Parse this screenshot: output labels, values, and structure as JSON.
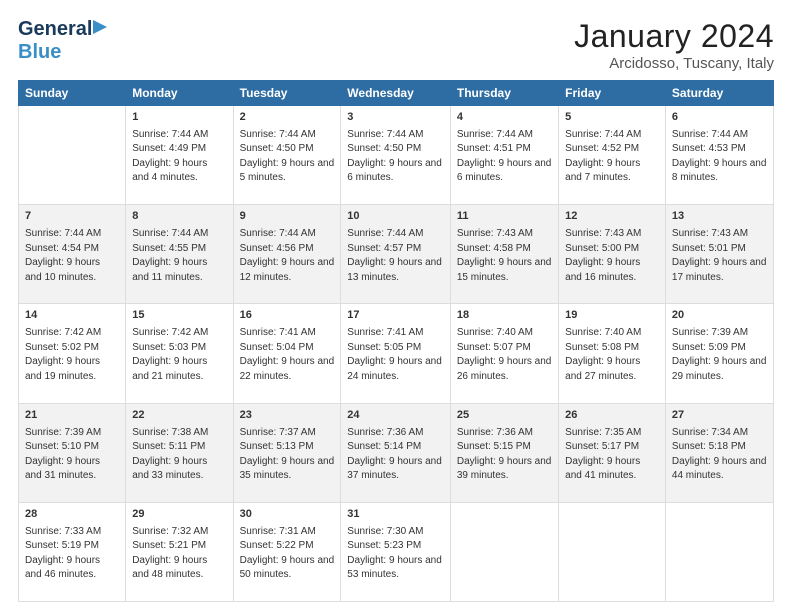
{
  "header": {
    "logo_line1": "General",
    "logo_line2": "Blue",
    "title": "January 2024",
    "subtitle": "Arcidosso, Tuscany, Italy"
  },
  "columns": [
    "Sunday",
    "Monday",
    "Tuesday",
    "Wednesday",
    "Thursday",
    "Friday",
    "Saturday"
  ],
  "rows": [
    [
      {
        "day": "",
        "sunrise": "",
        "sunset": "",
        "daylight": ""
      },
      {
        "day": "1",
        "sunrise": "Sunrise: 7:44 AM",
        "sunset": "Sunset: 4:49 PM",
        "daylight": "Daylight: 9 hours and 4 minutes."
      },
      {
        "day": "2",
        "sunrise": "Sunrise: 7:44 AM",
        "sunset": "Sunset: 4:50 PM",
        "daylight": "Daylight: 9 hours and 5 minutes."
      },
      {
        "day": "3",
        "sunrise": "Sunrise: 7:44 AM",
        "sunset": "Sunset: 4:50 PM",
        "daylight": "Daylight: 9 hours and 6 minutes."
      },
      {
        "day": "4",
        "sunrise": "Sunrise: 7:44 AM",
        "sunset": "Sunset: 4:51 PM",
        "daylight": "Daylight: 9 hours and 6 minutes."
      },
      {
        "day": "5",
        "sunrise": "Sunrise: 7:44 AM",
        "sunset": "Sunset: 4:52 PM",
        "daylight": "Daylight: 9 hours and 7 minutes."
      },
      {
        "day": "6",
        "sunrise": "Sunrise: 7:44 AM",
        "sunset": "Sunset: 4:53 PM",
        "daylight": "Daylight: 9 hours and 8 minutes."
      }
    ],
    [
      {
        "day": "7",
        "sunrise": "Sunrise: 7:44 AM",
        "sunset": "Sunset: 4:54 PM",
        "daylight": "Daylight: 9 hours and 10 minutes."
      },
      {
        "day": "8",
        "sunrise": "Sunrise: 7:44 AM",
        "sunset": "Sunset: 4:55 PM",
        "daylight": "Daylight: 9 hours and 11 minutes."
      },
      {
        "day": "9",
        "sunrise": "Sunrise: 7:44 AM",
        "sunset": "Sunset: 4:56 PM",
        "daylight": "Daylight: 9 hours and 12 minutes."
      },
      {
        "day": "10",
        "sunrise": "Sunrise: 7:44 AM",
        "sunset": "Sunset: 4:57 PM",
        "daylight": "Daylight: 9 hours and 13 minutes."
      },
      {
        "day": "11",
        "sunrise": "Sunrise: 7:43 AM",
        "sunset": "Sunset: 4:58 PM",
        "daylight": "Daylight: 9 hours and 15 minutes."
      },
      {
        "day": "12",
        "sunrise": "Sunrise: 7:43 AM",
        "sunset": "Sunset: 5:00 PM",
        "daylight": "Daylight: 9 hours and 16 minutes."
      },
      {
        "day": "13",
        "sunrise": "Sunrise: 7:43 AM",
        "sunset": "Sunset: 5:01 PM",
        "daylight": "Daylight: 9 hours and 17 minutes."
      }
    ],
    [
      {
        "day": "14",
        "sunrise": "Sunrise: 7:42 AM",
        "sunset": "Sunset: 5:02 PM",
        "daylight": "Daylight: 9 hours and 19 minutes."
      },
      {
        "day": "15",
        "sunrise": "Sunrise: 7:42 AM",
        "sunset": "Sunset: 5:03 PM",
        "daylight": "Daylight: 9 hours and 21 minutes."
      },
      {
        "day": "16",
        "sunrise": "Sunrise: 7:41 AM",
        "sunset": "Sunset: 5:04 PM",
        "daylight": "Daylight: 9 hours and 22 minutes."
      },
      {
        "day": "17",
        "sunrise": "Sunrise: 7:41 AM",
        "sunset": "Sunset: 5:05 PM",
        "daylight": "Daylight: 9 hours and 24 minutes."
      },
      {
        "day": "18",
        "sunrise": "Sunrise: 7:40 AM",
        "sunset": "Sunset: 5:07 PM",
        "daylight": "Daylight: 9 hours and 26 minutes."
      },
      {
        "day": "19",
        "sunrise": "Sunrise: 7:40 AM",
        "sunset": "Sunset: 5:08 PM",
        "daylight": "Daylight: 9 hours and 27 minutes."
      },
      {
        "day": "20",
        "sunrise": "Sunrise: 7:39 AM",
        "sunset": "Sunset: 5:09 PM",
        "daylight": "Daylight: 9 hours and 29 minutes."
      }
    ],
    [
      {
        "day": "21",
        "sunrise": "Sunrise: 7:39 AM",
        "sunset": "Sunset: 5:10 PM",
        "daylight": "Daylight: 9 hours and 31 minutes."
      },
      {
        "day": "22",
        "sunrise": "Sunrise: 7:38 AM",
        "sunset": "Sunset: 5:11 PM",
        "daylight": "Daylight: 9 hours and 33 minutes."
      },
      {
        "day": "23",
        "sunrise": "Sunrise: 7:37 AM",
        "sunset": "Sunset: 5:13 PM",
        "daylight": "Daylight: 9 hours and 35 minutes."
      },
      {
        "day": "24",
        "sunrise": "Sunrise: 7:36 AM",
        "sunset": "Sunset: 5:14 PM",
        "daylight": "Daylight: 9 hours and 37 minutes."
      },
      {
        "day": "25",
        "sunrise": "Sunrise: 7:36 AM",
        "sunset": "Sunset: 5:15 PM",
        "daylight": "Daylight: 9 hours and 39 minutes."
      },
      {
        "day": "26",
        "sunrise": "Sunrise: 7:35 AM",
        "sunset": "Sunset: 5:17 PM",
        "daylight": "Daylight: 9 hours and 41 minutes."
      },
      {
        "day": "27",
        "sunrise": "Sunrise: 7:34 AM",
        "sunset": "Sunset: 5:18 PM",
        "daylight": "Daylight: 9 hours and 44 minutes."
      }
    ],
    [
      {
        "day": "28",
        "sunrise": "Sunrise: 7:33 AM",
        "sunset": "Sunset: 5:19 PM",
        "daylight": "Daylight: 9 hours and 46 minutes."
      },
      {
        "day": "29",
        "sunrise": "Sunrise: 7:32 AM",
        "sunset": "Sunset: 5:21 PM",
        "daylight": "Daylight: 9 hours and 48 minutes."
      },
      {
        "day": "30",
        "sunrise": "Sunrise: 7:31 AM",
        "sunset": "Sunset: 5:22 PM",
        "daylight": "Daylight: 9 hours and 50 minutes."
      },
      {
        "day": "31",
        "sunrise": "Sunrise: 7:30 AM",
        "sunset": "Sunset: 5:23 PM",
        "daylight": "Daylight: 9 hours and 53 minutes."
      },
      {
        "day": "",
        "sunrise": "",
        "sunset": "",
        "daylight": ""
      },
      {
        "day": "",
        "sunrise": "",
        "sunset": "",
        "daylight": ""
      },
      {
        "day": "",
        "sunrise": "",
        "sunset": "",
        "daylight": ""
      }
    ]
  ]
}
